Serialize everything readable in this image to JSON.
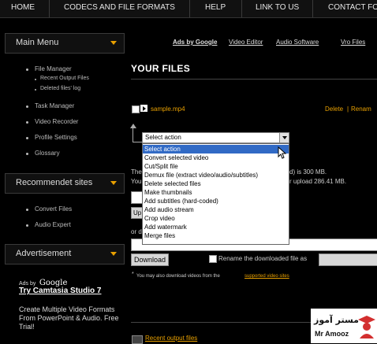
{
  "nav": {
    "items": [
      "HOME",
      "CODECS AND FILE FORMATS",
      "HELP",
      "LINK TO US",
      "CONTACT FO"
    ]
  },
  "sidebar": {
    "main_menu_title": "Main Menu",
    "main_items": [
      {
        "label": "File Manager",
        "subs": [
          "Recent Output Files",
          "Deleted files' log"
        ]
      },
      {
        "label": "Task Manager"
      },
      {
        "label": "Video Recorder"
      },
      {
        "label": "Profile Settings"
      },
      {
        "label": "Glossary"
      }
    ],
    "recommended_title": "Recommendet sites",
    "recommended_items": [
      "Convert Files",
      "Audio Expert"
    ],
    "advertisement_title": "Advertisement",
    "ad": {
      "ads_by": "Ads by",
      "brand": "Google",
      "link": "Try Camtasia Studio 7",
      "text": "Create Multiple Video Formats From PowerPoint & Audio. Free Trial!"
    }
  },
  "top_links": {
    "ads_by_google": "Ads by Google",
    "video_editor": "Video Editor",
    "audio_software": "Audio Software",
    "vro_files": "Vro Files"
  },
  "main": {
    "title": "YOUR FILES",
    "file_name": "sample.mp4",
    "delete": "Delete",
    "rename": "Renam",
    "action_separator": "|",
    "select_value": "Select action",
    "options": [
      "Select action",
      "Convert selected video",
      "Cut/Split file",
      "Demux file (extract video/audio/subtitles)",
      "Delete selected files",
      "Make thumbnails",
      "Add subtitles (hard-coded)",
      "Add audio stream",
      "Crop video",
      "Add watermark",
      "Merge files"
    ],
    "selected_index": 0,
    "behind_text_1_left": "The",
    "behind_text_1_right": "d) is 300 MB.",
    "behind_text_2_left": "You",
    "behind_text_2_right": "r upload 286.41 MB.",
    "upload_partial": "Up",
    "or_partial": "or d",
    "download_button": "Download",
    "rename_label": "Rename the downloaded file as",
    "note_star": "*",
    "note_text": "You may also download videos from the",
    "note_link": "supported video sites",
    "recent_output": "Recent output files"
  },
  "watermark": {
    "name_fa": "مستر آموز",
    "name_en": "Mr Amooz"
  },
  "colors": {
    "accent": "#e8a000",
    "selection": "#316ac5",
    "background": "#000000"
  }
}
